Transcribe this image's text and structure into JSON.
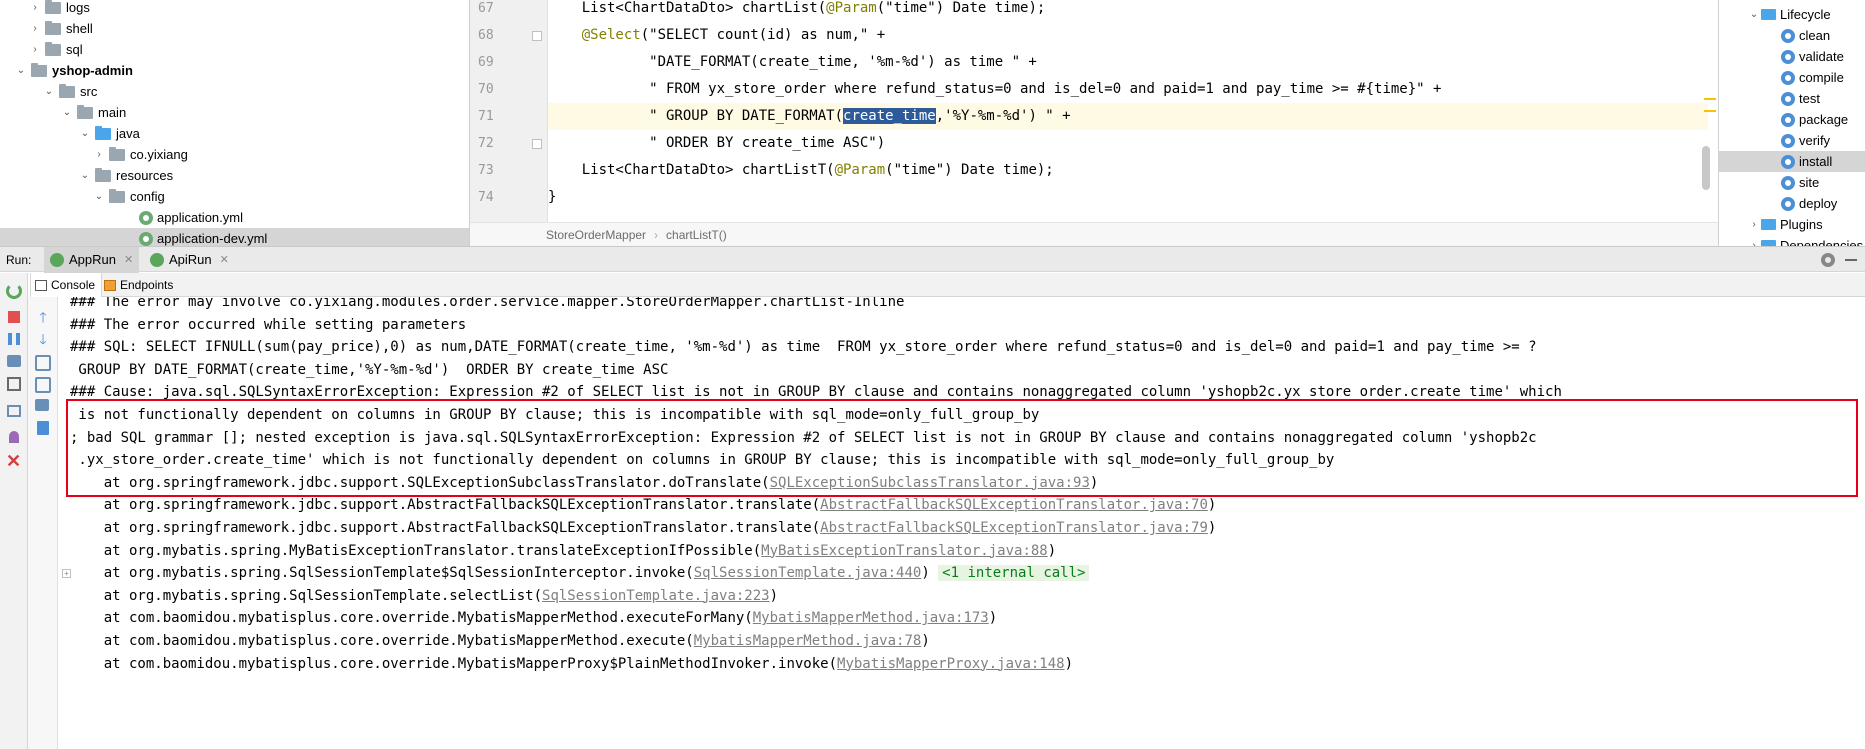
{
  "project_tree": {
    "items": [
      {
        "label": "logs",
        "type": "folder",
        "arrow": "right"
      },
      {
        "label": "shell",
        "type": "folder",
        "arrow": "right"
      },
      {
        "label": "sql",
        "type": "folder",
        "arrow": "right"
      },
      {
        "label": "yshop-admin",
        "type": "folder",
        "arrow": "down",
        "bold": true
      },
      {
        "label": "src",
        "type": "folder",
        "arrow": "down"
      },
      {
        "label": "main",
        "type": "folder",
        "arrow": "down"
      },
      {
        "label": "java",
        "type": "folder-blue",
        "arrow": "down"
      },
      {
        "label": "co.yixiang",
        "type": "folder",
        "arrow": "right"
      },
      {
        "label": "resources",
        "type": "folder",
        "arrow": "down"
      },
      {
        "label": "config",
        "type": "folder",
        "arrow": "down"
      },
      {
        "label": "application.yml",
        "type": "yml"
      },
      {
        "label": "application-dev.yml",
        "type": "yml",
        "selected": true
      }
    ]
  },
  "editor": {
    "lines": [
      {
        "number": "67",
        "segments": [
          {
            "t": "    List<ChartDataDto> chartList("
          },
          {
            "t": "@Param",
            "c": "ann"
          },
          {
            "t": "(\"time\") Date time);"
          }
        ]
      },
      {
        "number": "68",
        "segments": [
          {
            "t": "    "
          },
          {
            "t": "@Select",
            "c": "ann"
          },
          {
            "t": "(\"SELECT count(id) as num,\" +"
          }
        ]
      },
      {
        "number": "69",
        "segments": [
          {
            "t": "            \"DATE_FORMAT(create_time, '%m-%d') as time \" +"
          }
        ]
      },
      {
        "number": "70",
        "segments": [
          {
            "t": "            \" FROM yx_store_order where refund_status=0 and is_del=0 and paid=1 and pay_time >= #{time}\" +"
          }
        ]
      },
      {
        "number": "71",
        "current": true,
        "segments": [
          {
            "t": "            \" GROUP BY DATE_FORMAT("
          },
          {
            "t": "create_time",
            "c": "sel"
          },
          {
            "t": ",'%Y-%m-%d') \" +"
          }
        ]
      },
      {
        "number": "72",
        "segments": [
          {
            "t": "            \" ORDER BY create_time ASC\")"
          }
        ]
      },
      {
        "number": "73",
        "segments": [
          {
            "t": "    List<ChartDataDto> chartListT("
          },
          {
            "t": "@Param",
            "c": "ann"
          },
          {
            "t": "(\"time\") Date time);"
          }
        ]
      },
      {
        "number": "74",
        "segments": [
          {
            "t": "}"
          }
        ]
      }
    ],
    "breadcrumb": [
      "StoreOrderMapper",
      "chartListT()"
    ]
  },
  "maven": {
    "items": [
      {
        "label": "Lifecycle",
        "type": "folder",
        "arrow": "down"
      },
      {
        "label": "clean",
        "type": "goal"
      },
      {
        "label": "validate",
        "type": "goal"
      },
      {
        "label": "compile",
        "type": "goal"
      },
      {
        "label": "test",
        "type": "goal"
      },
      {
        "label": "package",
        "type": "goal"
      },
      {
        "label": "verify",
        "type": "goal"
      },
      {
        "label": "install",
        "type": "goal",
        "selected": true
      },
      {
        "label": "site",
        "type": "goal"
      },
      {
        "label": "deploy",
        "type": "goal"
      },
      {
        "label": "Plugins",
        "type": "folder",
        "arrow": "right"
      },
      {
        "label": "Dependencies",
        "type": "folder",
        "arrow": "right"
      }
    ]
  },
  "run": {
    "label": "Run:",
    "tabs": [
      {
        "label": "AppRun",
        "active": true
      },
      {
        "label": "ApiRun",
        "active": false
      }
    ],
    "console_tabs": [
      {
        "label": "Console",
        "active": true
      },
      {
        "label": "Endpoints",
        "active": false
      }
    ]
  },
  "console": {
    "lines": [
      {
        "segments": [
          {
            "t": "### The error may involve co.yixiang.modules.order.service.mapper.StoreOrderMapper.chartList-Inline"
          }
        ]
      },
      {
        "segments": [
          {
            "t": "### The error occurred while setting parameters"
          }
        ]
      },
      {
        "segments": [
          {
            "t": "### SQL: SELECT IFNULL(sum(pay_price),0) as num,DATE_FORMAT(create_time, '%m-%d') as time  FROM yx_store_order where refund_status=0 and is_del=0 and paid=1 and pay_time >= ?"
          }
        ]
      },
      {
        "segments": [
          {
            "t": " GROUP BY DATE_FORMAT(create_time,'%Y-%m-%d')  ORDER BY create_time ASC"
          }
        ]
      },
      {
        "segments": [
          {
            "t": "### Cause: java.sql.SQLSyntaxErrorException: Expression #2 of SELECT list is not in GROUP BY clause and contains nonaggregated column 'yshopb2c.yx_store_order.create_time' which"
          }
        ]
      },
      {
        "segments": [
          {
            "t": " is not functionally dependent on columns in GROUP BY clause; this is incompatible with sql_mode=only_full_group_by"
          }
        ]
      },
      {
        "segments": [
          {
            "t": "; bad SQL grammar []; nested exception is java.sql.SQLSyntaxErrorException: Expression #2 of SELECT list is not in GROUP BY clause and contains nonaggregated column 'yshopb2c"
          }
        ]
      },
      {
        "segments": [
          {
            "t": " .yx_store_order.create_time' which is not functionally dependent on columns in GROUP BY clause; this is incompatible with sql_mode=only_full_group_by"
          }
        ]
      },
      {
        "segments": [
          {
            "t": "    at org.springframework.jdbc.support.SQLExceptionSubclassTranslator.doTranslate("
          },
          {
            "t": "SQLExceptionSubclassTranslator.java:93",
            "c": "link"
          },
          {
            "t": ")"
          }
        ]
      },
      {
        "segments": [
          {
            "t": "    at org.springframework.jdbc.support.AbstractFallbackSQLExceptionTranslator.translate("
          },
          {
            "t": "AbstractFallbackSQLExceptionTranslator.java:70",
            "c": "link"
          },
          {
            "t": ")"
          }
        ]
      },
      {
        "segments": [
          {
            "t": "    at org.springframework.jdbc.support.AbstractFallbackSQLExceptionTranslator.translate("
          },
          {
            "t": "AbstractFallbackSQLExceptionTranslator.java:79",
            "c": "link"
          },
          {
            "t": ")"
          }
        ]
      },
      {
        "segments": [
          {
            "t": "    at org.mybatis.spring.MyBatisExceptionTranslator.translateExceptionIfPossible("
          },
          {
            "t": "MyBatisExceptionTranslator.java:88",
            "c": "link"
          },
          {
            "t": ")"
          }
        ]
      },
      {
        "expand": true,
        "segments": [
          {
            "t": "    at org.mybatis.spring.SqlSessionTemplate$SqlSessionInterceptor.invoke("
          },
          {
            "t": "SqlSessionTemplate.java:440",
            "c": "link"
          },
          {
            "t": ") "
          },
          {
            "t": "<1 internal call>",
            "c": "tag"
          }
        ]
      },
      {
        "segments": [
          {
            "t": "    at org.mybatis.spring.SqlSessionTemplate.selectList("
          },
          {
            "t": "SqlSessionTemplate.java:223",
            "c": "link"
          },
          {
            "t": ")"
          }
        ]
      },
      {
        "segments": [
          {
            "t": "    at com.baomidou.mybatisplus.core.override.MybatisMapperMethod.executeForMany("
          },
          {
            "t": "MybatisMapperMethod.java:173",
            "c": "link"
          },
          {
            "t": ")"
          }
        ]
      },
      {
        "segments": [
          {
            "t": "    at com.baomidou.mybatisplus.core.override.MybatisMapperMethod.execute("
          },
          {
            "t": "MybatisMapperMethod.java:78",
            "c": "link"
          },
          {
            "t": ")"
          }
        ]
      },
      {
        "segments": [
          {
            "t": "    at com.baomidou.mybatisplus.core.override.MybatisMapperProxy$PlainMethodInvoker.invoke("
          },
          {
            "t": "MybatisMapperProxy.java:148",
            "c": "link"
          },
          {
            "t": ")"
          }
        ]
      }
    ]
  },
  "colors": {
    "highlight_box": "#e5001a",
    "selection": "#2d5b9a",
    "annotation": "#808000",
    "string": "#067d17"
  }
}
